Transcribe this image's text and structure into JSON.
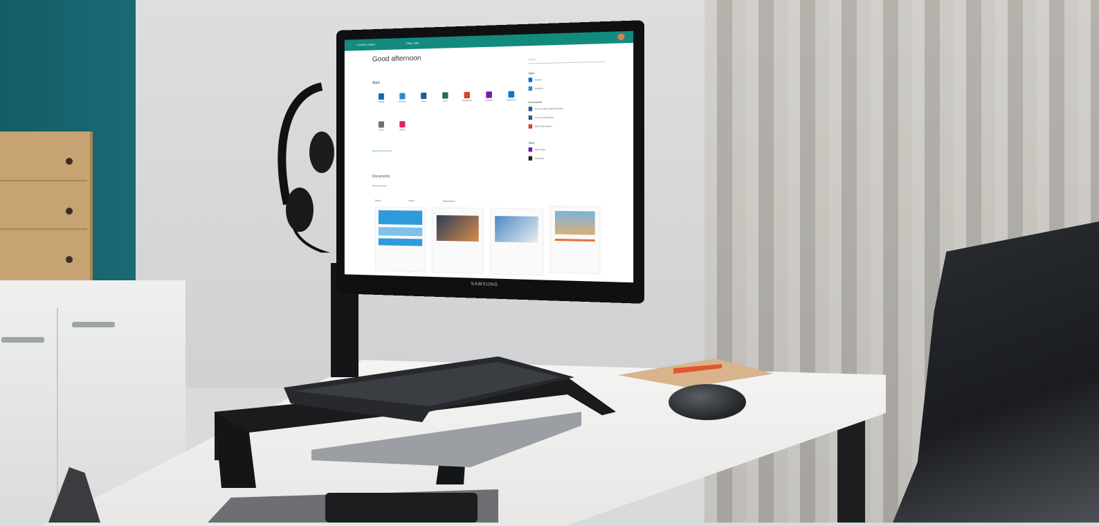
{
  "screen": {
    "topbar": {
      "app_name": "Contoso Sales",
      "section": "Office 365"
    },
    "greeting": "Good afternoon",
    "apps_heading": "Apps",
    "apps": [
      {
        "label": "Outlook",
        "color": "#0f6cbd"
      },
      {
        "label": "OneDrive",
        "color": "#2a8bd8"
      },
      {
        "label": "Word",
        "color": "#2b579a"
      },
      {
        "label": "Excel",
        "color": "#217346"
      },
      {
        "label": "PowerPoint",
        "color": "#d24726"
      },
      {
        "label": "OneNote",
        "color": "#7719aa"
      },
      {
        "label": "SharePoint",
        "color": "#0b78c4"
      },
      {
        "label": "Teams",
        "color": "#6b6f78"
      },
      {
        "label": "Stream",
        "color": "#e0245e"
      }
    ],
    "explore_link": "Explore all your apps",
    "search_placeholder": "Search",
    "side": {
      "apps_head": "Apps",
      "app_items": [
        "Outlook",
        "OneDrive"
      ],
      "docs_head": "Documents",
      "doc_items": [
        "Contoso Sales Marketing Plan",
        "Contoso Q3 Results",
        "WDP Sales Report"
      ],
      "sites_head": "Sites",
      "site_items": [
        "Sales Team",
        "Marketing"
      ]
    },
    "documents_heading": "Documents",
    "recent_label": "Recommended",
    "doc_tabs": [
      "Recent",
      "Pinned",
      "Shared with me"
    ],
    "monitor_brand": "SAMSUNG"
  },
  "colors": {
    "topbar": "#138a7e",
    "wall_teal": "#135d66"
  }
}
